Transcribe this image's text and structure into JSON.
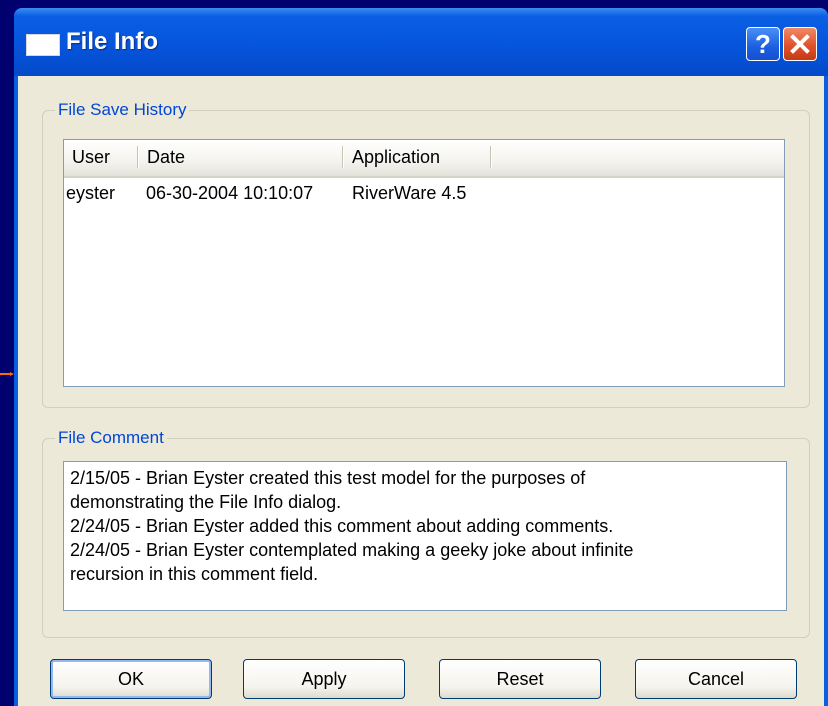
{
  "window": {
    "title": "File Info",
    "help_label": "?",
    "close_label": "✕"
  },
  "history": {
    "legend": "File Save History",
    "columns": [
      "User",
      "Date",
      "Application"
    ],
    "rows": [
      {
        "user": "eyster",
        "date": "06-30-2004 10:10:07",
        "application": "RiverWare 4.5"
      }
    ]
  },
  "comment": {
    "legend": "File Comment",
    "lines": [
      "2/15/05 - Brian Eyster created this test model for the purposes of",
      "demonstrating the File Info dialog.",
      "2/24/05 - Brian Eyster added this comment about adding comments.",
      "2/24/05 - Brian Eyster contemplated making a geeky joke about infinite",
      "recursion in this comment field."
    ]
  },
  "buttons": {
    "ok": "OK",
    "apply": "Apply",
    "reset": "Reset",
    "cancel": "Cancel"
  },
  "colors": {
    "desktop": "#00006e",
    "titlebar": "#0655dc",
    "client": "#ece9d8",
    "legend_text": "#0046d5",
    "arrow": "#ff6a00"
  }
}
